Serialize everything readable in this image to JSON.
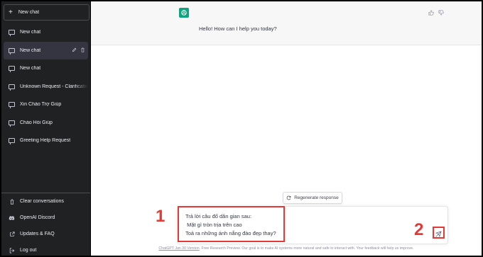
{
  "sidebar": {
    "new_chat_button": "New chat",
    "chats": [
      {
        "label": "New chat",
        "active": false
      },
      {
        "label": "New chat",
        "active": true
      },
      {
        "label": "New chat",
        "active": false
      },
      {
        "label": "Unknown Request - Clarificatio",
        "active": false
      },
      {
        "label": "Xin Chào Trợ Giúp",
        "active": false
      },
      {
        "label": "Chào Hỏi Giúp",
        "active": false
      },
      {
        "label": "Greeting Help Request",
        "active": false
      }
    ],
    "bottom": [
      {
        "label": "Clear conversations",
        "icon": "trash-icon"
      },
      {
        "label": "OpenAI Discord",
        "icon": "discord-icon"
      },
      {
        "label": "Updates & FAQ",
        "icon": "external-link-icon"
      },
      {
        "label": "Log out",
        "icon": "logout-icon"
      }
    ]
  },
  "conversation": {
    "assistant_message": "Hello! How can I help you today?"
  },
  "regenerate_label": "Regenerate response",
  "input": {
    "lines": [
      "Trả lời câu đố dân gian sau:",
      " Mặt gì tròn trịa trên cao",
      "Toả ra những ánh nắng đào đẹp thay?"
    ]
  },
  "footer": {
    "link": "ChatGPT Jan 30 Version",
    "text": ". Free Research Preview. Our goal is to make AI systems more natural and safe to interact with. Your feedback will help us improve."
  },
  "annotations": {
    "label_1": "1",
    "label_2": "2",
    "color": "#e53935"
  },
  "colors": {
    "sidebar_bg": "#202123",
    "accent": "#10a37f",
    "assistant_bg": "#f7f7f8"
  }
}
